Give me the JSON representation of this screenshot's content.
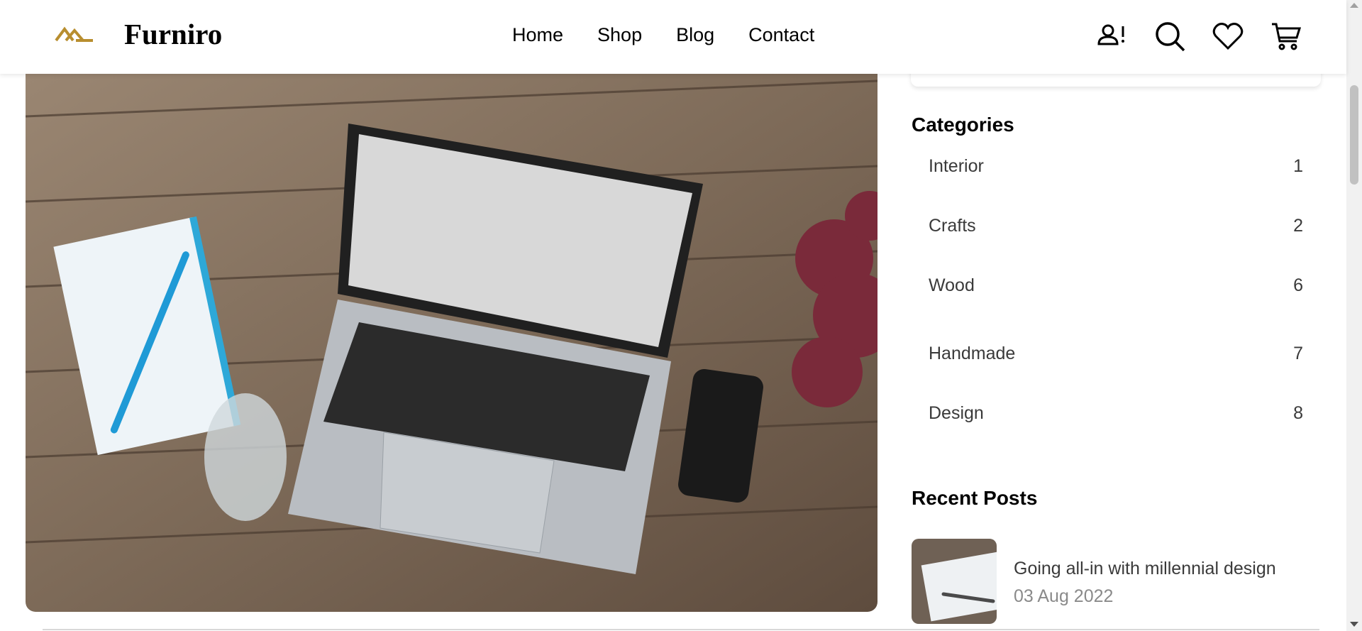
{
  "brand": {
    "name": "Furniro",
    "logo": "furniro-logo",
    "accent": "#B88E2F"
  },
  "nav": {
    "items": [
      "Home",
      "Shop",
      "Blog",
      "Contact"
    ]
  },
  "header_icons": [
    "account-alert-icon",
    "search-icon",
    "heart-icon",
    "cart-icon"
  ],
  "hero": {
    "image": "laptop-on-wooden-table-photo"
  },
  "sidebar": {
    "categories_title": "Categories",
    "categories": [
      {
        "name": "Interior",
        "count": "1"
      },
      {
        "name": "Crafts",
        "count": "2"
      },
      {
        "name": "Wood",
        "count": "6"
      },
      {
        "name": "Handmade",
        "count": "7"
      },
      {
        "name": "Design",
        "count": "8"
      }
    ],
    "recent_title": "Recent Posts",
    "recent_posts": [
      {
        "title": "Going all-in with millennial design",
        "date": "03 Aug 2022",
        "thumb": "notebook-pen-photo"
      }
    ]
  }
}
